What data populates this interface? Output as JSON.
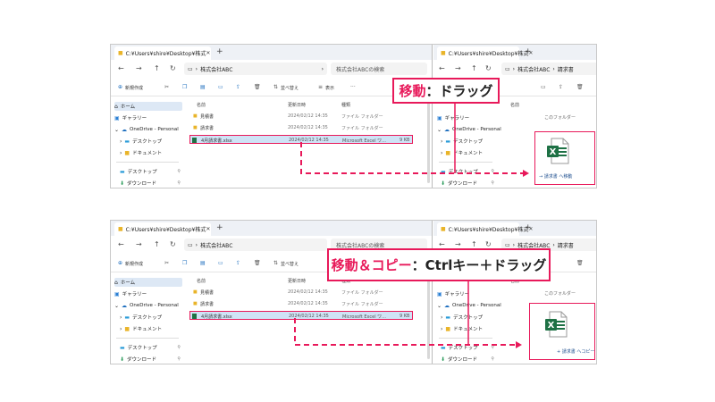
{
  "explorer": {
    "tab_title_left": "C:¥Users¥shire¥Desktop¥株式",
    "tab_title_right": "C:¥Users¥shire¥Desktop¥株式",
    "path_left": "株式会社ABC",
    "path_right_1": "株式会社ABC",
    "path_right_2": "請求書",
    "search_placeholder": "株式会社ABCの検索",
    "toolbar_new": "新規作成",
    "toolbar_sort": "並べ替え",
    "toolbar_view": "表示",
    "sidebar": {
      "home": "ホーム",
      "gallery": "ギャラリー",
      "onedrive": "OneDrive - Personal",
      "desktop": "デスクトップ",
      "documents": "ドキュメント",
      "desktop2": "デスクトップ",
      "downloads": "ダウンロード"
    },
    "columns": {
      "name": "名前",
      "date": "更新日時",
      "type": "種類"
    },
    "rows": [
      {
        "name": "見積書",
        "date": "2024/02/12 14:35",
        "type": "ファイル フォルダー",
        "size": ""
      },
      {
        "name": "請求書",
        "date": "2024/02/12 14:35",
        "type": "ファイル フォルダー",
        "size": ""
      },
      {
        "name": "4月請求書.xlsx",
        "date": "2024/02/12 14:35",
        "type": "Microsoft Excel ワ...",
        "size": "9 KB"
      }
    ],
    "right_col_name": "名前",
    "empty_folder_msg": "このフォルダー",
    "excel_letter": "X"
  },
  "panel1": {
    "callout_pink": "移動",
    "callout_rest": "：ドラッグ",
    "drop_tip": "→ 請求書 へ移動"
  },
  "panel2": {
    "callout_pink": "移動＆コピー",
    "callout_rest": "：Ctrlキー＋ドラッグ",
    "drop_tip": "+ 請求書 へコピー"
  },
  "colors": {
    "accent": "#e8195a",
    "excel_green": "#1e7145"
  }
}
